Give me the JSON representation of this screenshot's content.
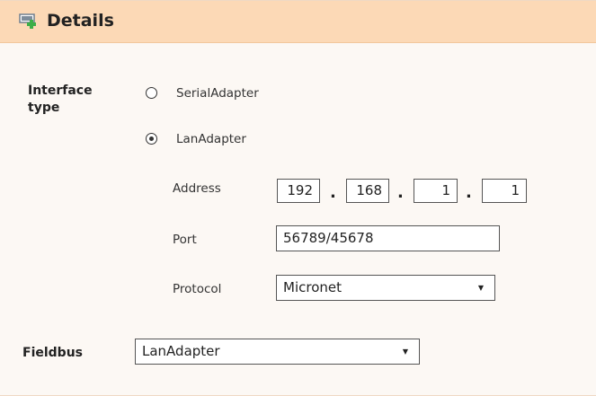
{
  "header": {
    "title": "Details"
  },
  "interface": {
    "label": "Interface type",
    "options": [
      {
        "label": "SerialAdapter",
        "selected": false
      },
      {
        "label": "LanAdapter",
        "selected": true
      }
    ]
  },
  "lan": {
    "address_label": "Address",
    "address": [
      "192",
      "168",
      "1",
      "1"
    ],
    "address_separator": ".",
    "port_label": "Port",
    "port_value": "56789/45678",
    "protocol_label": "Protocol",
    "protocol_value": "Micronet"
  },
  "fieldbus": {
    "label": "Fieldbus",
    "value": "LanAdapter"
  },
  "colors": {
    "header_bg": "#fcd9b6",
    "panel_bg": "#fcf8f4",
    "icon_green": "#3dae47",
    "icon_gray": "#6f7f8f"
  }
}
